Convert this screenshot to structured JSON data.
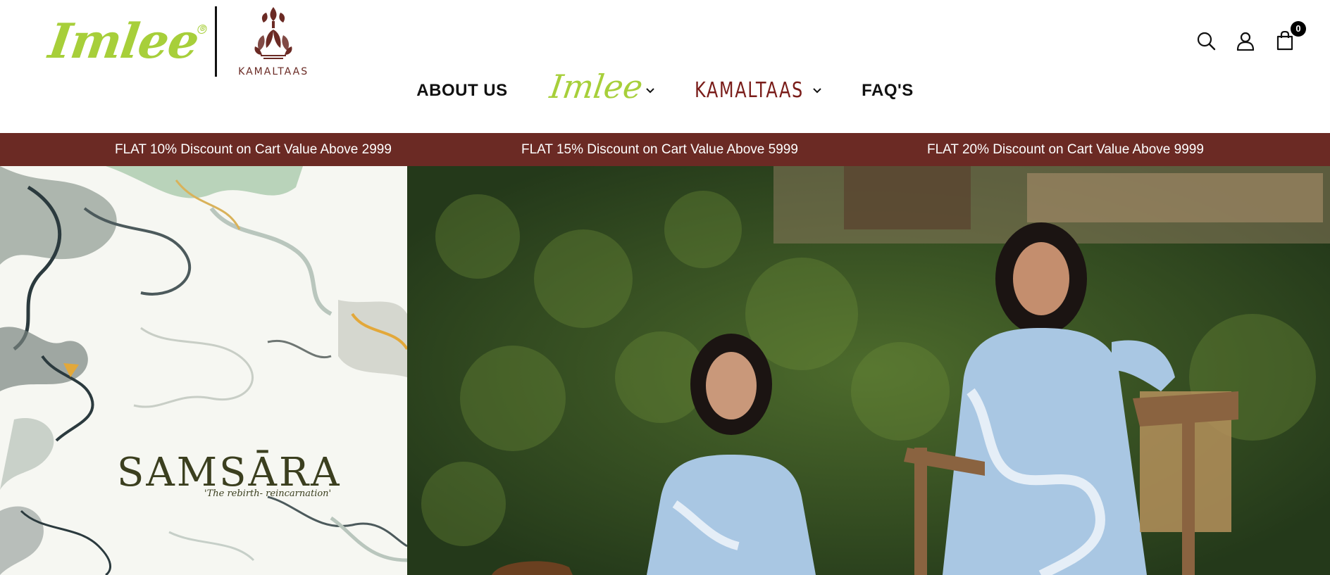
{
  "brand": {
    "imlee": "Imlee",
    "kamaltaas": "KAMALTAAS"
  },
  "header": {
    "cart_count": "0",
    "icons": [
      "search-icon",
      "user-icon",
      "shopping-bag-icon"
    ]
  },
  "nav": {
    "about": "ABOUT US",
    "imlee": "Imlee",
    "kamaltaas": "KAMALTAAS",
    "faq": "FAQ'S"
  },
  "promo": {
    "items": [
      "FLAT 10% Discount on Cart Value Above 2999",
      "FLAT 15% Discount on Cart Value Above 5999",
      "FLAT 20% Discount on Cart Value Above 9999"
    ]
  },
  "hero": {
    "collection_title": "SAMSĀRA",
    "collection_subtitle": "'The rebirth- reincarnation'"
  },
  "colors": {
    "imlee_green": "#a7cf3a",
    "kamaltaas_maroon": "#6b2a24",
    "promo_bg": "#6b2a24"
  }
}
